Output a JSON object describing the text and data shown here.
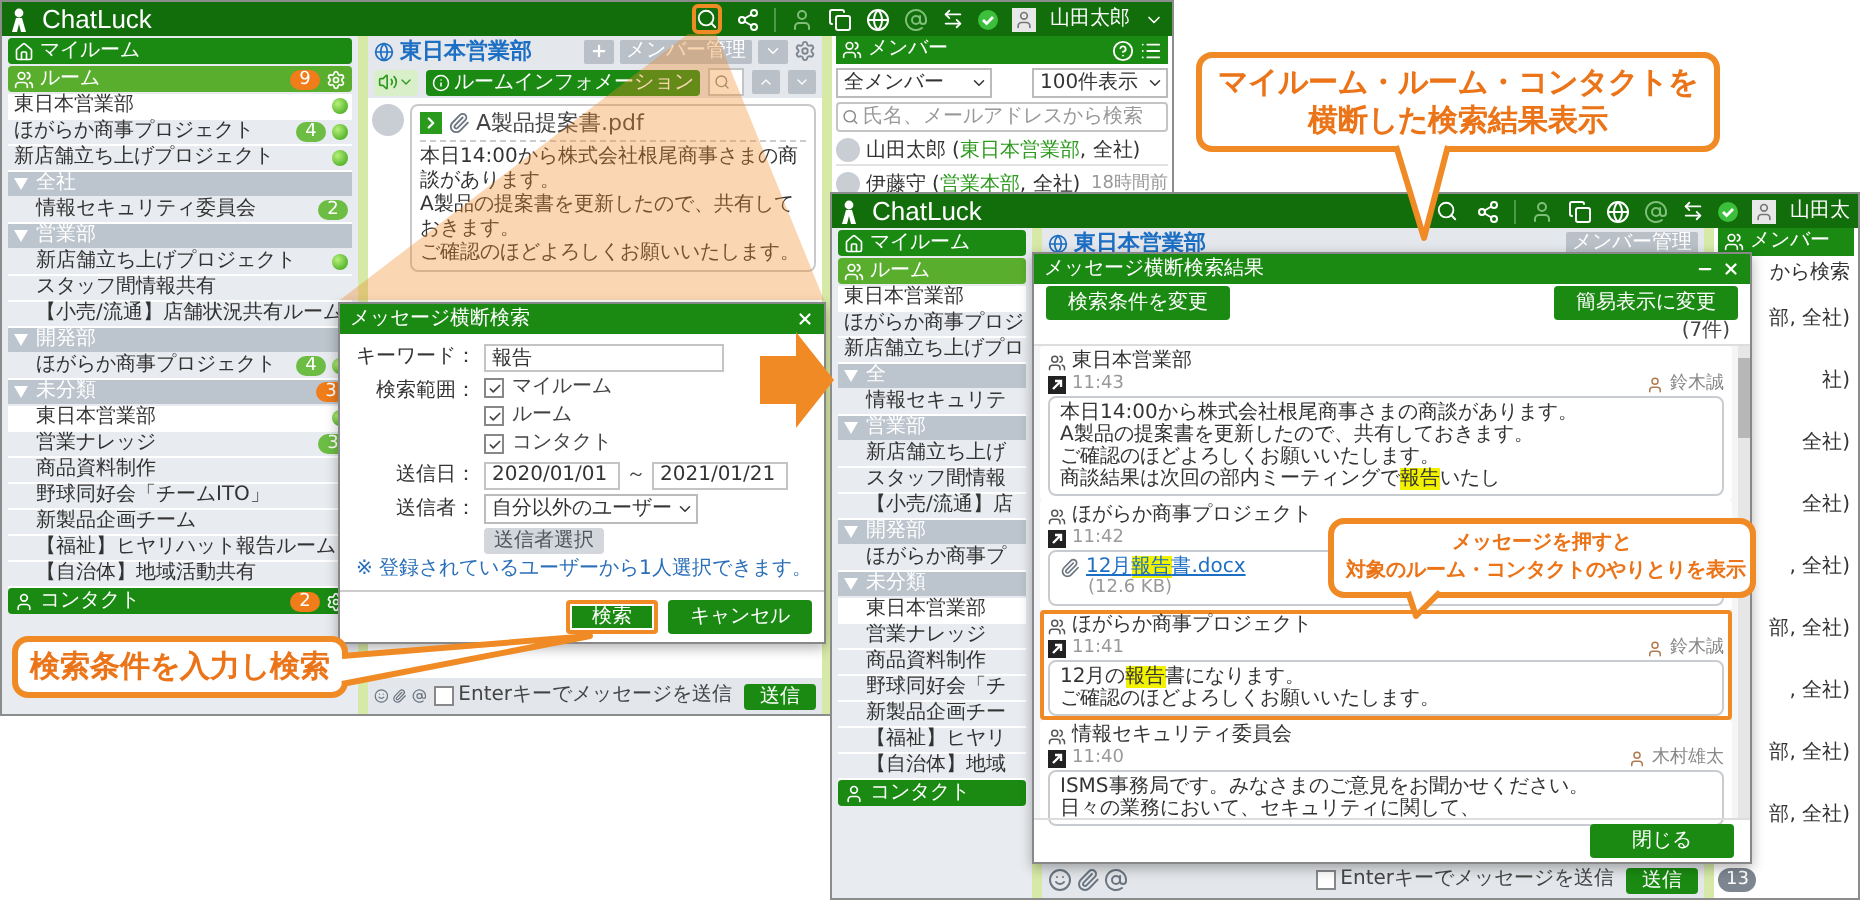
{
  "left_app": {
    "logo": "ChatLuck",
    "search_icon_highlighted": true,
    "user": "山田太郎",
    "user_menu": true,
    "sidebar": {
      "myroom": "マイルーム",
      "rooms": {
        "label": "ルーム",
        "badge": "9",
        "settings_icon": true
      },
      "items": [
        {
          "name": "東日本営業部",
          "selected": true,
          "online": true
        },
        {
          "name": "ほがらか商事プロジェクト",
          "selected": false,
          "online": true,
          "badge": "4"
        },
        {
          "name": "新店舗立ち上げプロジェクト",
          "selected": false,
          "online": true
        }
      ],
      "groups": [
        {
          "name": "全社",
          "children": [
            {
              "name": "情報セキュリティ委員会",
              "selected": false,
              "online": false,
              "badge": "2"
            }
          ]
        },
        {
          "name": "営業部",
          "children": [
            {
              "name": "新店舗立ち上げプロジェクト",
              "selected": false,
              "online": true
            },
            {
              "name": "スタッフ間情報共有",
              "selected": false,
              "online": false
            },
            {
              "name": "【小売/流通】店舗状況共有ルーム",
              "selected": false,
              "online": false
            }
          ]
        },
        {
          "name": "開発部",
          "children": [
            {
              "name": "ほがらか商事プロジェクト",
              "selected": false,
              "online": true,
              "badge": "4"
            }
          ]
        },
        {
          "name": "未分類",
          "badge": "3",
          "children": [
            {
              "name": "東日本営業部",
              "selected": true,
              "online": true
            },
            {
              "name": "営業ナレッジ",
              "selected": false,
              "online": false,
              "badge": "3"
            },
            {
              "name": "商品資料制作",
              "selected": false,
              "online": false
            },
            {
              "name": "野球同好会「チームITO」",
              "selected": false,
              "online": false
            },
            {
              "name": "新製品企画チーム",
              "selected": false,
              "online": false
            },
            {
              "name": "【福祉】ヒヤリハット報告ルーム",
              "selected": false,
              "online": false
            },
            {
              "name": "【自治体】地域活動共有",
              "selected": false,
              "online": false
            }
          ]
        }
      ],
      "contacts": {
        "label": "コンタクト",
        "badge": "2",
        "settings_icon": true
      }
    },
    "room": {
      "title": "東日本営業部",
      "member_button": "メンバー管理",
      "info_button": "ルームインフォメーション",
      "message": {
        "file": "A製品提案書.pdf",
        "lines": [
          "本日14:00から株式会社根尾商事さまの商談があります。",
          "A製品の提案書を更新したので、共有しておきます。",
          "ご確認のほどよろしくお願いいたします。"
        ]
      }
    },
    "composer": {
      "enter_label": "Enterキーでメッセージを送信",
      "enter_checked": false,
      "send": "送信"
    },
    "members": {
      "title": "メンバー",
      "filter": "全メンバー",
      "page_size": "100件表示",
      "search_placeholder": "氏名、メールアドレスから検索",
      "list": [
        {
          "name": "山田太郎",
          "open": "(",
          "dept": "東日本営業部",
          "rest": ", 全社)"
        },
        {
          "name": "伊藤守",
          "open": "(",
          "dept": "営業本部",
          "rest": ", 全社)",
          "time": "18時間前"
        }
      ]
    },
    "search_dialog": {
      "title": "メッセージ横断検索",
      "keyword_label": "キーワード：",
      "keyword": "報告",
      "scope_label": "検索範囲：",
      "scopes": [
        {
          "label": "マイルーム",
          "checked": true
        },
        {
          "label": "ルーム",
          "checked": true
        },
        {
          "label": "コンタクト",
          "checked": true
        }
      ],
      "date_label": "送信日：",
      "date_from": "2020/01/01",
      "date_sep": "～",
      "date_to": "2021/01/21",
      "sender_label": "送信者：",
      "sender": "自分以外のユーザー",
      "sender_button": {
        "label": "送信者選択",
        "disabled": true
      },
      "note": "※ 登録されているユーザーから1人選択できます。",
      "search_button": {
        "label": "検索",
        "highlighted": true
      },
      "cancel_button": "キャンセル"
    }
  },
  "right_app": {
    "logo": "ChatLuck",
    "search_icon_highlighted": false,
    "user": "山田太",
    "sidebar": {
      "myroom": "マイルーム",
      "rooms": {
        "label": "ルーム"
      },
      "items": [
        {
          "name": "東日本営業部",
          "selected": true
        },
        {
          "name": "ほがらか商事プロジ",
          "selected": false
        },
        {
          "name": "新店舗立ち上げプロ",
          "selected": false
        }
      ],
      "groups": [
        {
          "name": "全",
          "children": [
            {
              "name": "情報セキュリテ",
              "selected": false
            }
          ]
        },
        {
          "name": "営業部",
          "children": [
            {
              "name": "新店舗立ち上げ",
              "selected": false
            },
            {
              "name": "スタッフ間情報",
              "selected": false
            },
            {
              "name": "【小売/流通】店",
              "selected": false
            }
          ]
        },
        {
          "name": "開発部",
          "children": [
            {
              "name": "ほがらか商事プ",
              "selected": false
            }
          ]
        },
        {
          "name": "未分類",
          "children": [
            {
              "name": "東日本営業部",
              "selected": true
            },
            {
              "name": "営業ナレッジ",
              "selected": false
            },
            {
              "name": "商品資料制作",
              "selected": false
            },
            {
              "name": "野球同好会「チ",
              "selected": false
            },
            {
              "name": "新製品企画チー",
              "selected": false
            },
            {
              "name": "【福祉】ヒヤリ",
              "selected": false
            },
            {
              "name": "【自治体】地域",
              "selected": false
            }
          ]
        }
      ],
      "contacts": {
        "label": "コンタクト"
      }
    },
    "room": {
      "title": "東日本営業部",
      "member_button": "メンバー管理"
    },
    "composer": {
      "enter_label": "Enterキーでメッセージを送信",
      "enter_checked": false,
      "send": "送信"
    },
    "members": {
      "title": "メンバー",
      "search_fragment": "から検索",
      "fragments": [
        "部, 全社)",
        "社)",
        "全社)",
        "全社)",
        ", 全社)",
        "部, 全社)",
        ", 全社)",
        "部, 全社)",
        "部, 全社)"
      ],
      "count": "13"
    },
    "results_dialog": {
      "title": "メッセージ横断検索結果",
      "change_button": "検索条件を変更",
      "simple_button": "簡易表示に変更",
      "count": "(7件)",
      "results": [
        {
          "room": "東日本営業部",
          "time": "11:43",
          "author": "鈴木誠",
          "kind": "text",
          "selected": false,
          "lines": [
            "本日14:00から株式会社根尾商事さまの商談があります。",
            "A製品の提案書を更新したので、共有しておきます。",
            "ご確認のほどよろしくお願いいたします。",
            "商談結果は次回の部内ミーティングで**報告**いたし"
          ]
        },
        {
          "room": "ほがらか商事プロジェクト",
          "time": "11:42",
          "kind": "file",
          "selected": false,
          "file": "12月**報告**書.docx",
          "size": "(12.6 KB)"
        },
        {
          "room": "ほがらか商事プロジェクト",
          "time": "11:41",
          "author": "鈴木誠",
          "kind": "text",
          "selected": true,
          "lines": [
            "12月の**報告**書になります。",
            "ご確認のほどよろしくお願いいたします。"
          ]
        },
        {
          "room": "情報セキュリティ委員会",
          "time": "11:40",
          "author": "木村雄太",
          "kind": "text",
          "selected": false,
          "lines": [
            "ISMS事務局です。みなさまのご意見をお聞かせください。",
            "日々の業務において、セキュリティに関して、"
          ]
        }
      ],
      "close_button": "閉じる"
    }
  },
  "callouts": [
    {
      "lines": [
        "検索条件を入力し検索"
      ]
    },
    {
      "lines": [
        "マイルーム・ルーム・コンタクトを",
        "横断した検索結果表示"
      ]
    },
    {
      "lines": [
        "メッセージを押すと",
        "対象のルーム・コンタクトのやりとりを表示"
      ]
    }
  ]
}
